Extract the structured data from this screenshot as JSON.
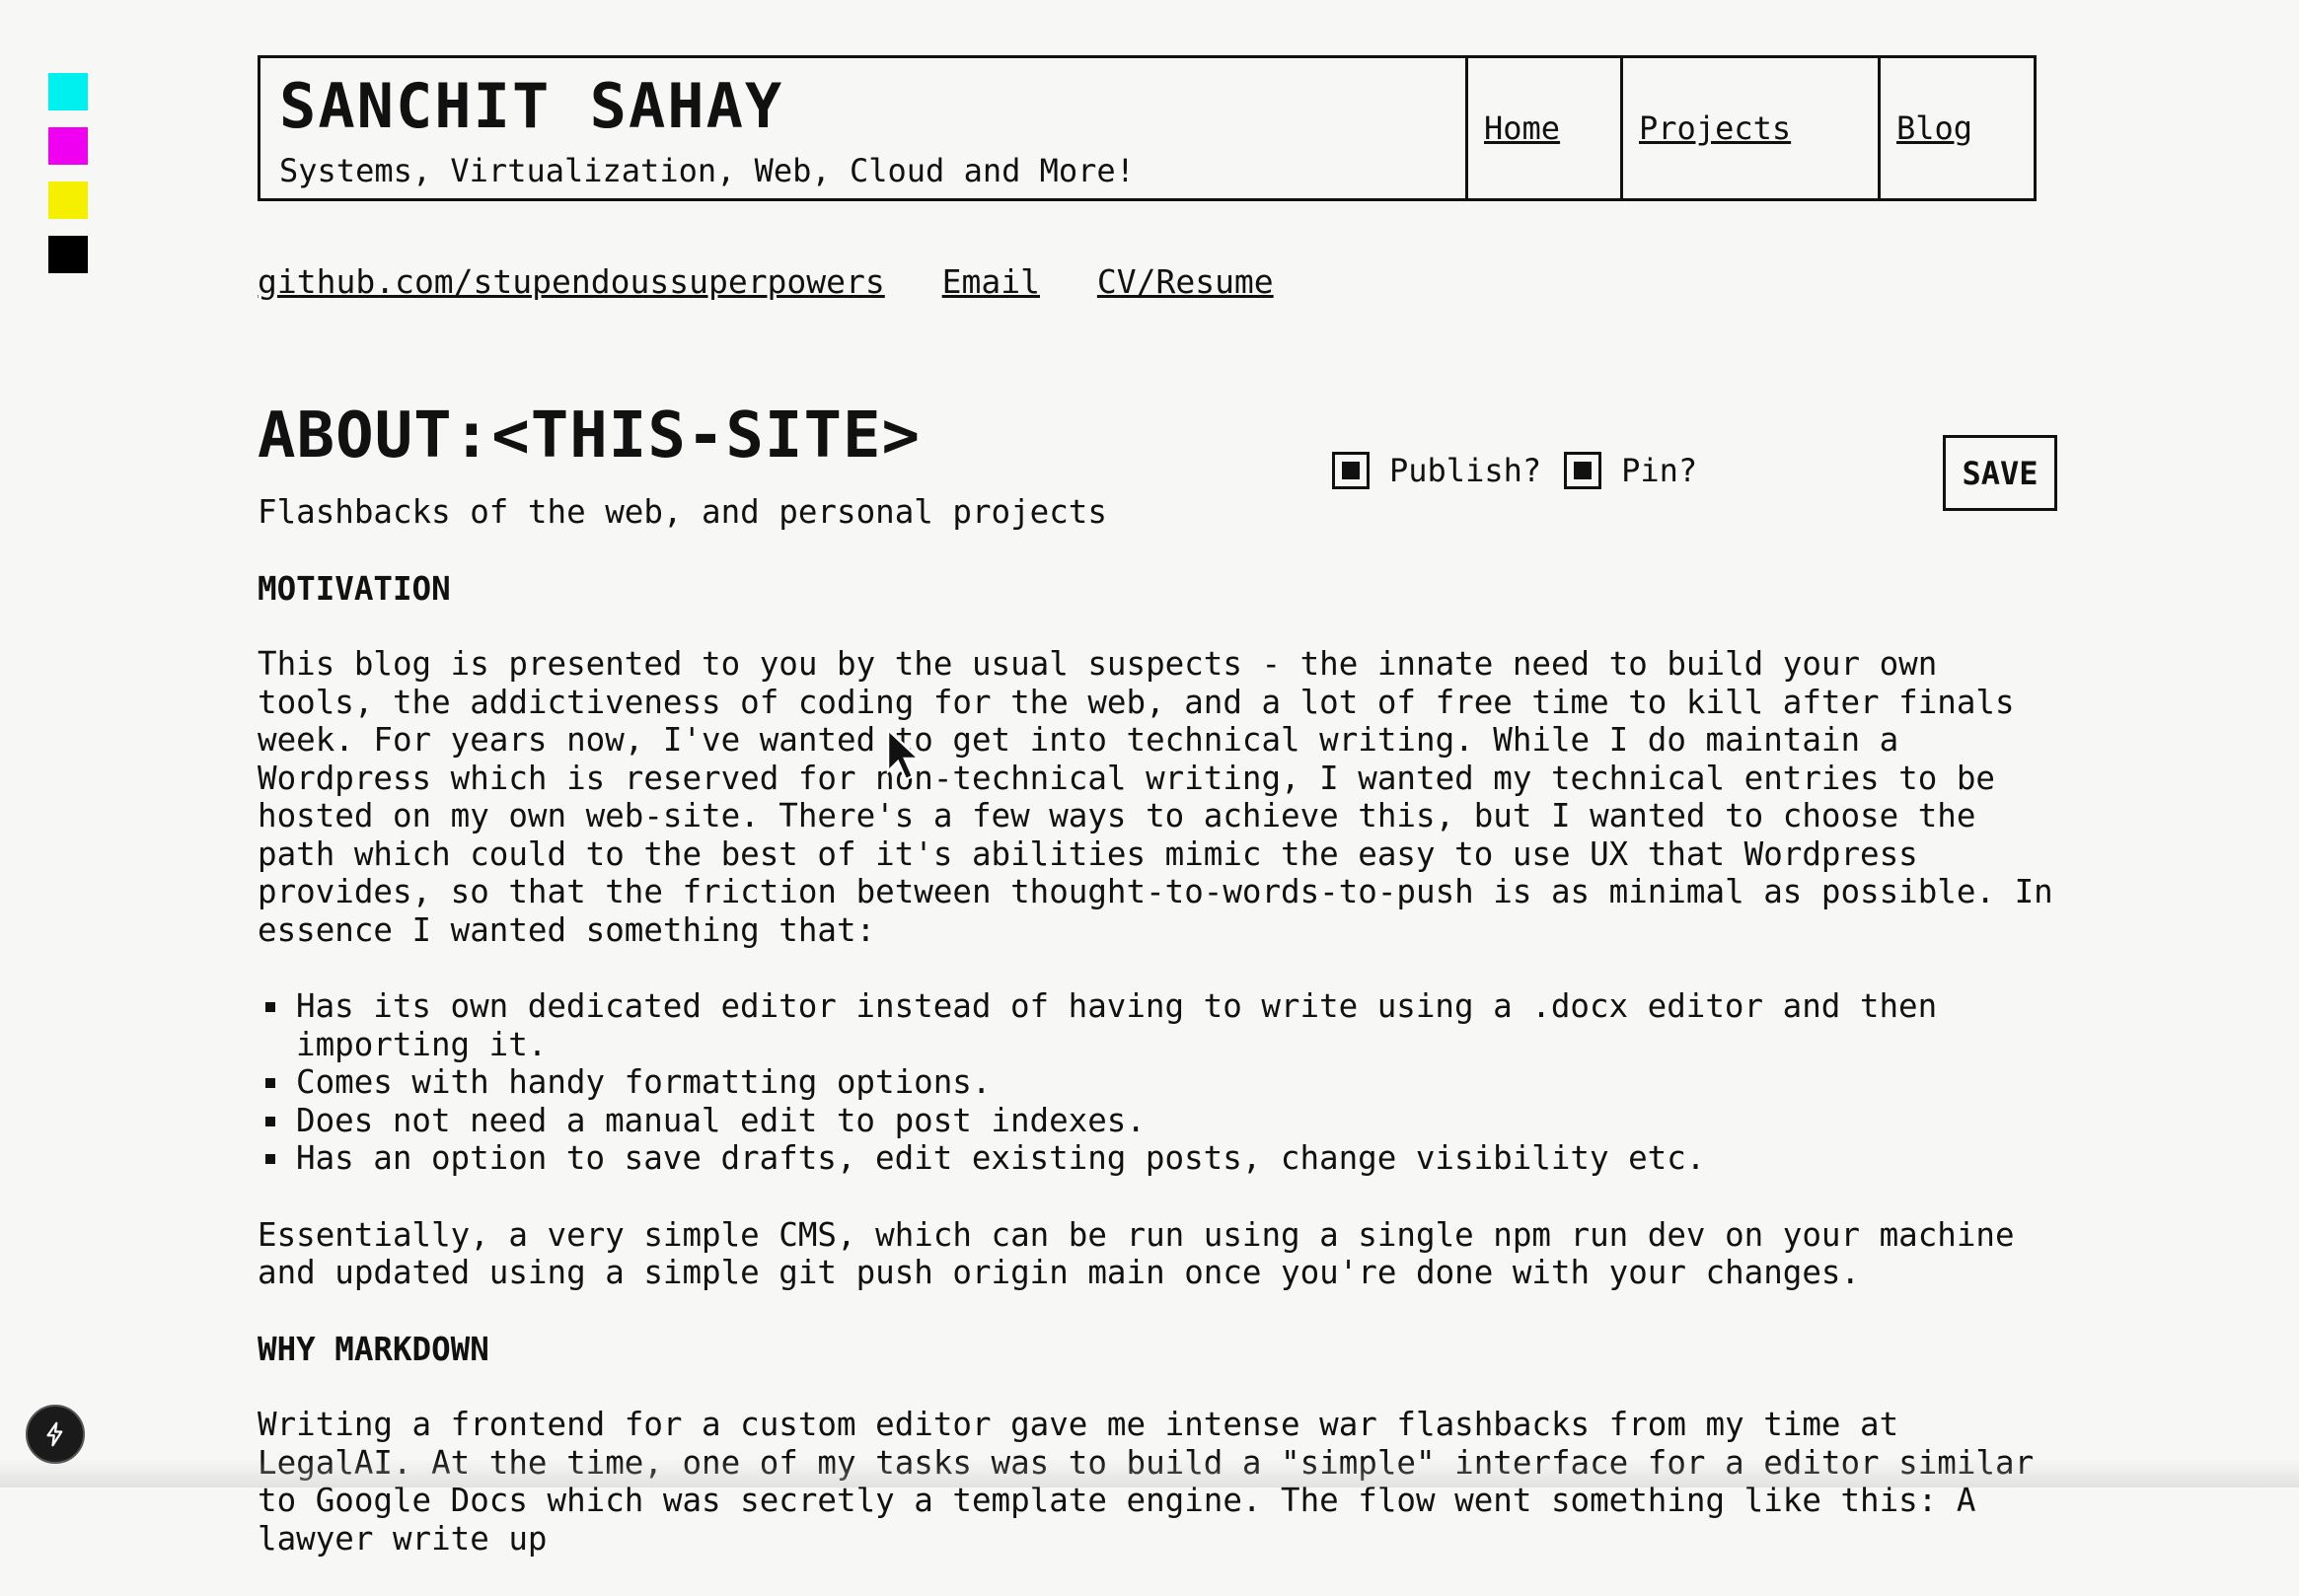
{
  "palette": [
    {
      "name": "cyan",
      "color": "#00f0f0"
    },
    {
      "name": "magenta",
      "color": "#f000f0"
    },
    {
      "name": "yellow",
      "color": "#f5f000"
    },
    {
      "name": "black",
      "color": "#000000"
    }
  ],
  "header": {
    "title": "SANCHIT SAHAY",
    "subtitle": "Systems, Virtualization, Web, Cloud and More!",
    "nav": {
      "home": "Home",
      "projects": "Projects",
      "blog": "Blog"
    }
  },
  "links": {
    "github": "github.com/stupendoussuperpowers",
    "email": "Email",
    "cv": "CV/Resume"
  },
  "post": {
    "title": "ABOUT:<THIS-SITE>",
    "subtitle": "Flashbacks of the web, and personal projects",
    "publish_label": "Publish?",
    "publish_checked": true,
    "pin_label": "Pin?",
    "pin_checked": true,
    "save_label": "SAVE",
    "motivation_heading": "MOTIVATION",
    "motivation_p1": "This blog is presented to you by the usual suspects - the innate need to build your own tools, the addictiveness of coding for the web, and a lot of free time to kill after finals week. For years now, I've wanted to get into technical writing. While I do maintain a Wordpress which is reserved for non-technical writing, I wanted my technical entries to be hosted on my own web-site. There's a few ways to achieve this, but I wanted to choose the path which could to the best of it's abilities mimic the easy to use UX that Wordpress provides, so that the friction between thought-to-words-to-push is as minimal as possible. In essence I wanted something that:",
    "bullets": [
      "Has its own dedicated editor instead of having to write using a .docx editor and then importing it.",
      "Comes with handy formatting options.",
      "Does not need a manual edit to post indexes.",
      "Has an option to save drafts, edit existing posts, change visibility etc."
    ],
    "motivation_p2": "Essentially, a very simple CMS, which can be run using a single npm run dev on your machine and updated using a simple git push origin main once you're done with your changes.",
    "markdown_heading": "WHY MARKDOWN",
    "markdown_p1": "Writing a frontend for a custom editor gave me intense war flashbacks from my time at LegalAI. At the time, one of my tasks was to build a \"simple\" interface for a editor similar to Google Docs which was secretly a template engine. The flow went something like this: A lawyer write up"
  },
  "icons": {
    "cursor": "mouse-pointer-icon",
    "badge": "lightning-bolt-icon"
  }
}
